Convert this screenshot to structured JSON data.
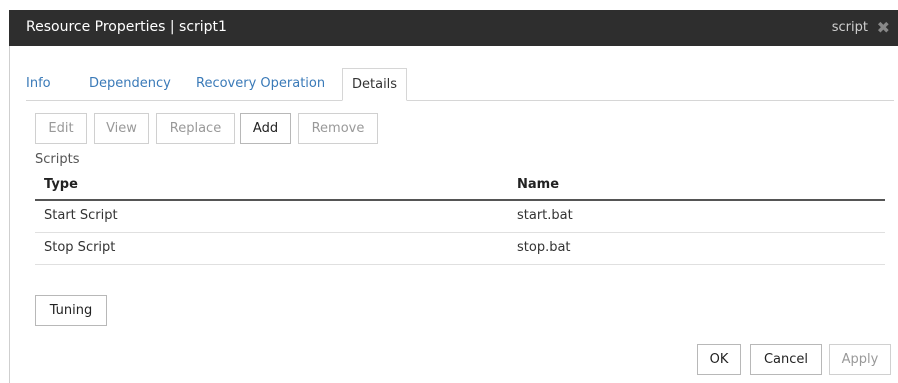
{
  "titlebar": {
    "title": "Resource Properties | script1",
    "tag": "script",
    "close": "✖"
  },
  "tabs": [
    {
      "label": "Info",
      "active": false
    },
    {
      "label": "Dependency",
      "active": false
    },
    {
      "label": "Recovery Operation",
      "active": false
    },
    {
      "label": "Details",
      "active": true
    }
  ],
  "toolbar": {
    "edit": "Edit",
    "view": "View",
    "replace": "Replace",
    "add": "Add",
    "remove": "Remove"
  },
  "scripts": {
    "label": "Scripts",
    "columns": [
      "Type",
      "Name"
    ],
    "rows": [
      {
        "type": "Start Script",
        "name": "start.bat"
      },
      {
        "type": "Stop Script",
        "name": "stop.bat"
      }
    ]
  },
  "tuning_label": "Tuning",
  "footer": {
    "ok": "OK",
    "cancel": "Cancel",
    "apply": "Apply"
  },
  "colors": {
    "titlebar_bg": "#2e2e2e",
    "tab_link": "#3a7ab8",
    "disabled_text": "#999999"
  }
}
